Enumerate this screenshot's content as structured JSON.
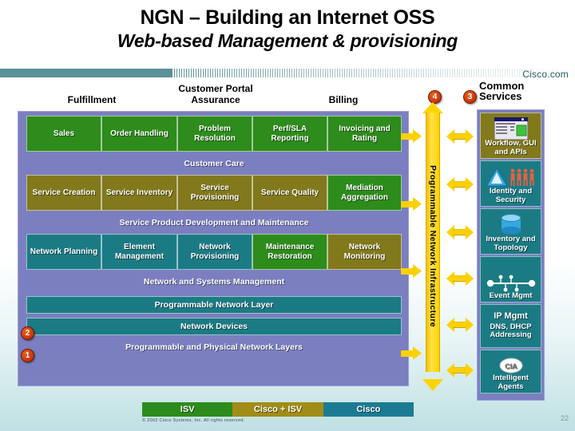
{
  "slide": {
    "title_line1": "NGN – Building an Internet OSS",
    "title_line2": "Web-based Management & provisioning",
    "brand": "Cisco.com",
    "copyright": "© 2002  Cisco Systems, Inc. All rights reserved.",
    "slide_number": "22"
  },
  "column_headers": {
    "customer_portal": "Customer Portal",
    "fulfillment": "Fulfillment",
    "assurance": "Assurance",
    "billing": "Billing"
  },
  "markers": {
    "one": "1",
    "two": "2",
    "three": "3",
    "four": "4"
  },
  "vertical_arrow": {
    "label": "Programmable Network Infrastructure"
  },
  "matrix": {
    "row1": [
      {
        "label": "Sales",
        "color": "#2d8c1b",
        "vendor": "ISV"
      },
      {
        "label": "Order Handling",
        "color": "#2d8c1b",
        "vendor": "ISV"
      },
      {
        "label": "Problem Resolution",
        "color": "#2d8c1b",
        "vendor": "ISV"
      },
      {
        "label": "Perf/SLA Reporting",
        "color": "#2d8c1b",
        "vendor": "ISV"
      },
      {
        "label": "Invoicing and Rating",
        "color": "#2d8c1b",
        "vendor": "ISV"
      }
    ],
    "band1": "Customer Care",
    "row2": [
      {
        "label": "Service Creation",
        "color": "#81791c",
        "vendor": "Cisco + ISV"
      },
      {
        "label": "Service Inventory",
        "color": "#81791c",
        "vendor": "Cisco + ISV"
      },
      {
        "label": "Service Provisioning",
        "color": "#81791c",
        "vendor": "Cisco + ISV"
      },
      {
        "label": "Service Quality",
        "color": "#81791c",
        "vendor": "Cisco + ISV"
      },
      {
        "label": "Mediation Aggregation",
        "color": "#2d8c1b",
        "vendor": "ISV"
      }
    ],
    "band2": "Service Product Development and Maintenance",
    "row3": [
      {
        "label": "Network Planning",
        "color": "#1b7b84",
        "vendor": "Cisco"
      },
      {
        "label": "Element Management",
        "color": "#1b7b84",
        "vendor": "Cisco"
      },
      {
        "label": "Network Provisioning",
        "color": "#1b7b84",
        "vendor": "Cisco"
      },
      {
        "label": "Maintenance Restoration",
        "color": "#2d8c1b",
        "vendor": "ISV"
      },
      {
        "label": "Network Monitoring",
        "color": "#81791c",
        "vendor": "Cisco + ISV"
      }
    ],
    "band3": "Network and Systems Management",
    "bar_programmable_network_layer": "Programmable Network Layer",
    "bar_network_devices": "Network Devices",
    "band4": "Programmable and Physical Network Layers"
  },
  "common_services": {
    "heading_line1": "Common",
    "heading_line2": "Services",
    "items": [
      {
        "label": "Workflow, GUI and APIs",
        "icon": "window-screenshot-icon",
        "color": "#81791c"
      },
      {
        "label": "Identity and Security",
        "icon": "shield-people-icon",
        "color": "#1b7b84"
      },
      {
        "label": "Inventory and Topology",
        "icon": "database-cylinder-icon",
        "color": "#1b7b84"
      },
      {
        "label": "Event Mgmt",
        "icon": "network-nodes-icon",
        "color": "#1b7b84"
      },
      {
        "label": "IP Mgmt",
        "sub": "DNS, DHCP Addressing",
        "icon": "none",
        "color": "#1b7b84"
      },
      {
        "label": "Intelligent Agents",
        "icon": "cia-badge-icon",
        "color": "#1b7b84"
      }
    ]
  },
  "legend": [
    {
      "label": "ISV",
      "color": "#2d8c1b"
    },
    {
      "label": "Cisco + ISV",
      "color": "#a08d17"
    },
    {
      "label": "Cisco",
      "color": "#1b7b93"
    }
  ]
}
